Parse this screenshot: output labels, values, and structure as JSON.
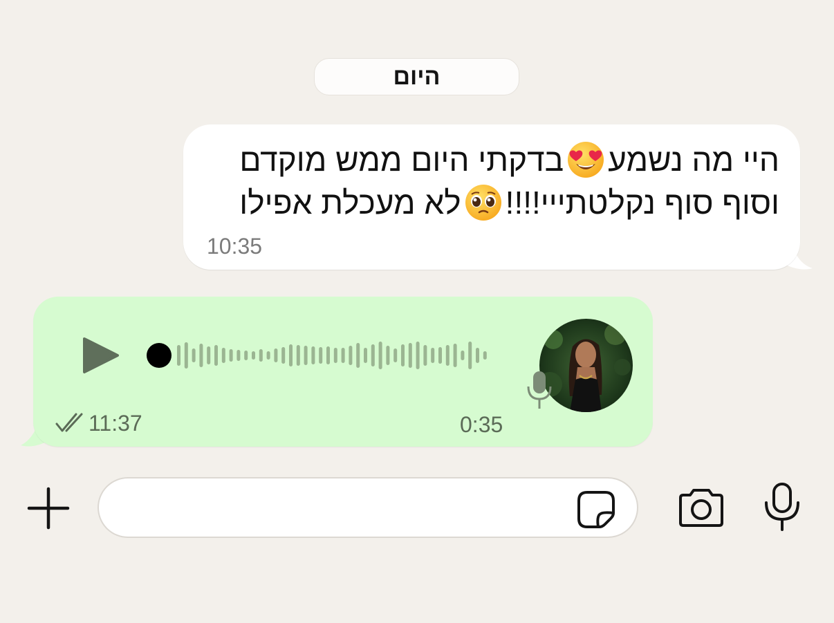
{
  "chat": {
    "date_label": "היום",
    "incoming_message": {
      "line1_part1": "היי מה נשמע",
      "line1_emoji": "heart-eyes-emoji",
      "line1_part2": "בדקתי היום ממש מוקדם",
      "line2_part1": "וסוף סוף נקלטתייי!!!!",
      "line2_emoji": "pleading-face-emoji",
      "line2_part2": "לא מעכלת אפילו",
      "time": "10:35"
    },
    "voice_message": {
      "duration": "0:35",
      "time": "11:37",
      "status_icon": "double-check-icon",
      "progress": 0
    }
  },
  "composer": {
    "placeholder": "",
    "value": ""
  },
  "colors": {
    "background": "#f3f0eb",
    "incoming_bubble": "#ffffff",
    "outgoing_bubble": "#d6fbd0",
    "waveform": "#9bb592",
    "play_icon": "#5f6f5b",
    "icon_dark": "#141414"
  },
  "icons": [
    "plus-icon",
    "sticker-icon",
    "camera-icon",
    "mic-icon",
    "play-icon",
    "double-check-icon"
  ]
}
